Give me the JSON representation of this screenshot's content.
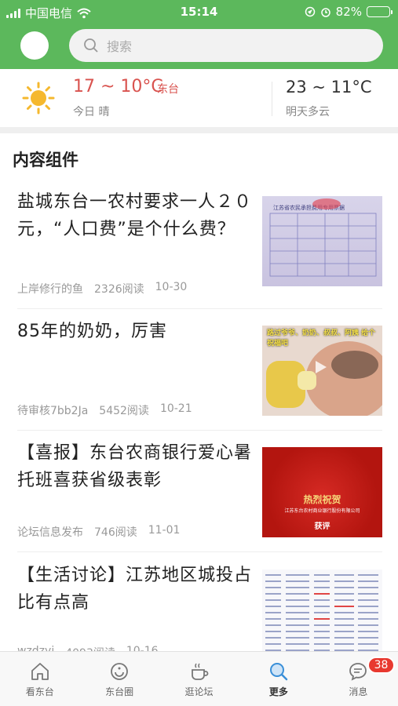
{
  "status": {
    "carrier": "中国电信",
    "time": "15:14",
    "battery": "82%",
    "battery_level": 0.82
  },
  "search": {
    "placeholder": "搜索"
  },
  "weather": {
    "today_temp": "17 ~ 10°C",
    "city": "东台",
    "today_desc": "今日 晴",
    "tomorrow_temp": "23 ~ 11°C",
    "tomorrow_desc": "明天多云"
  },
  "section_title": "内容组件",
  "articles": [
    {
      "title": "盐城东台一农村要求一人２０元，“人口费”是个什么费？",
      "author": "上岸修行的鱼",
      "reads": "2326阅读",
      "date": "10-30"
    },
    {
      "title": "85年的奶奶，厉害",
      "author": "待审核7bb2Ja",
      "reads": "5452阅读",
      "date": "10-21"
    },
    {
      "title": "【喜报】东台农商银行爱心暑托班喜获省级表彰",
      "author": "论坛信息发布",
      "reads": "746阅读",
      "date": "11-01"
    },
    {
      "title": "【生活讨论】江苏地区城投占比有点高",
      "author": "wzdzyj",
      "reads": "4093阅读",
      "date": "10-16"
    }
  ],
  "thumbs": {
    "t1_text": "江苏省农民承担费用专用票据",
    "t2_text": "路过爷爷、奶奶、叔叔、阿姨 给个祝福吧",
    "t3_title": "热烈祝贺",
    "t3_sub": "江苏东台农村商业银行股份有限公司",
    "t3_award": "获评"
  },
  "tabs": [
    {
      "label": "看东台",
      "icon": "home-icon"
    },
    {
      "label": "东台圈",
      "icon": "circle-icon"
    },
    {
      "label": "逛论坛",
      "icon": "coffee-icon"
    },
    {
      "label": "更多",
      "icon": "search-icon"
    },
    {
      "label": "消息",
      "icon": "message-icon",
      "badge": "38"
    }
  ],
  "colors": {
    "header_green": "#5cb85c",
    "temp_red": "#d9534f",
    "badge_red": "#e8382f"
  }
}
